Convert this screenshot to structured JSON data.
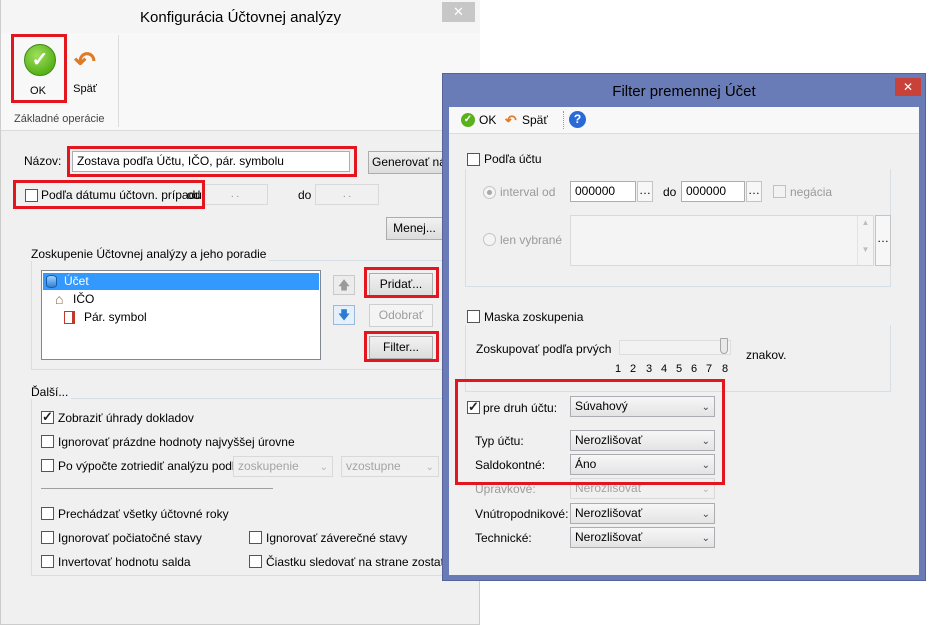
{
  "main_dialog": {
    "title": "Konfigurácia Účtovnej analýzy",
    "ribbon": {
      "ok_label": "OK",
      "back_label": "Späť",
      "group_label": "Základné operácie"
    },
    "name_label": "Názov:",
    "name_value": "Zostava podľa Účtu, IČO, pár. symbolu",
    "generate_button": "Generovať náz",
    "by_date_label": "Podľa dátumu účtovn. prípadu",
    "from_label": "od",
    "date_from_value": ". .",
    "to_label": "do",
    "date_to_value": ". .",
    "less_button": "Menej...",
    "grouping_label": "Zoskupenie Účtovnej analýzy a jeho poradie",
    "grouping_items": [
      "Účet",
      "IČO",
      "Pár. symbol"
    ],
    "add_button": "Pridať...",
    "remove_button": "Odobrať",
    "filter_button": "Filter...",
    "more_label": "Ďalší...",
    "show_payments_label": "Zobraziť úhrady dokladov",
    "ignore_empty_label": "Ignorovať prázdne hodnoty najvyššej úrovne",
    "sort_after_label": "Po výpočte zotriediť analýzu podľa...",
    "sort_by_value": "zoskupenie",
    "sort_order_value": "vzostupne",
    "all_years_label": "Prechádzať všetky účtovné roky",
    "ignore_opening_label": "Ignorovať počiatočné stavy",
    "ignore_closing_label": "Ignorovať záverečné stavy",
    "invert_balance_label": "Invertovať hodnotu salda",
    "amount_side_label": "Čiastku sledovať na strane zostatku",
    "show_payments_checked": true
  },
  "filter_dialog": {
    "title": "Filter premennej Účet",
    "toolbar": {
      "ok_label": "OK",
      "back_label": "Späť"
    },
    "by_account_label": "Podľa účtu",
    "interval_from_label": "interval od",
    "interval_from_value": "000000",
    "interval_to_label": "do",
    "interval_to_value": "000000",
    "negation_label": "negácia",
    "selected_only_label": "len vybrané",
    "mask_label": "Maska zoskupenia",
    "group_by_first_label": "Zoskupovať podľa prvých",
    "chars_label": "znakov.",
    "slider_ticks": [
      "1",
      "2",
      "3",
      "4",
      "5",
      "6",
      "7",
      "8"
    ],
    "slider_value": 8,
    "account_type_kind_label": "pre druh účtu:",
    "account_type_kind_value": "Súvahový",
    "account_type_label": "Typ účtu:",
    "account_type_value": "Nerozlišovať",
    "balance_label": "Saldokontné:",
    "balance_value": "Áno",
    "adjusting_label": "Úpravkové:",
    "adjusting_value": "Nerozlišovať",
    "intra_label": "Vnútropodnikové:",
    "intra_value": "Nerozlišovať",
    "technical_label": "Technické:",
    "technical_value": "Nerozlišovať"
  },
  "colors": {
    "accent_red": "#e3161f",
    "filter_frame": "#6a7cb7",
    "ok_green": "#59b21c",
    "selection_blue": "#3399ff"
  }
}
